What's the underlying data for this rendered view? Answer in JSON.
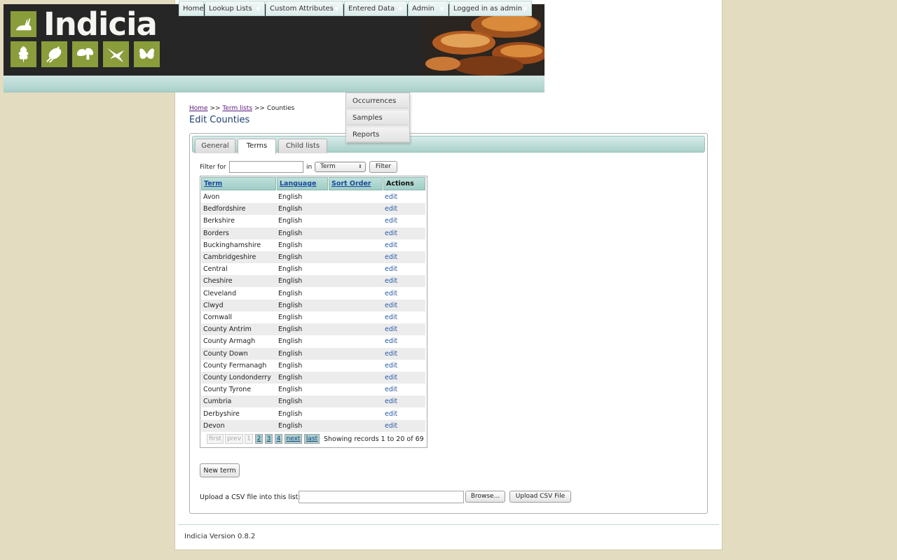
{
  "app": {
    "logo_text": "Indicia"
  },
  "nav": {
    "items": [
      {
        "label": "Home"
      },
      {
        "label": "Lookup Lists"
      },
      {
        "label": "Custom Attributes"
      },
      {
        "label": "Entered Data"
      },
      {
        "label": "Admin"
      },
      {
        "label": "Logged in as admin"
      }
    ],
    "dropdown": [
      "Occurrences",
      "Samples",
      "Reports"
    ]
  },
  "breadcrumb": {
    "home": "Home",
    "sep": ">>",
    "term_lists": "Term lists",
    "current": "Counties"
  },
  "page_title": "Edit Counties",
  "tabs": [
    {
      "label": "General"
    },
    {
      "label": "Terms"
    },
    {
      "label": "Child lists"
    }
  ],
  "filter": {
    "label": "Filter for",
    "in_label": "in",
    "value": "",
    "field": "Term",
    "button": "Filter"
  },
  "grid": {
    "headers": [
      "Term",
      "Language",
      "Sort Order",
      "Actions"
    ],
    "rows": [
      {
        "term": "Avon",
        "language": "English",
        "sort_order": "",
        "action": "edit"
      },
      {
        "term": "Bedfordshire",
        "language": "English",
        "sort_order": "",
        "action": "edit"
      },
      {
        "term": "Berkshire",
        "language": "English",
        "sort_order": "",
        "action": "edit"
      },
      {
        "term": "Borders",
        "language": "English",
        "sort_order": "",
        "action": "edit"
      },
      {
        "term": "Buckinghamshire",
        "language": "English",
        "sort_order": "",
        "action": "edit"
      },
      {
        "term": "Cambridgeshire",
        "language": "English",
        "sort_order": "",
        "action": "edit"
      },
      {
        "term": "Central",
        "language": "English",
        "sort_order": "",
        "action": "edit"
      },
      {
        "term": "Cheshire",
        "language": "English",
        "sort_order": "",
        "action": "edit"
      },
      {
        "term": "Cleveland",
        "language": "English",
        "sort_order": "",
        "action": "edit"
      },
      {
        "term": "Clwyd",
        "language": "English",
        "sort_order": "",
        "action": "edit"
      },
      {
        "term": "Cornwall",
        "language": "English",
        "sort_order": "",
        "action": "edit"
      },
      {
        "term": "County Antrim",
        "language": "English",
        "sort_order": "",
        "action": "edit"
      },
      {
        "term": "County Armagh",
        "language": "English",
        "sort_order": "",
        "action": "edit"
      },
      {
        "term": "County Down",
        "language": "English",
        "sort_order": "",
        "action": "edit"
      },
      {
        "term": "County Fermanagh",
        "language": "English",
        "sort_order": "",
        "action": "edit"
      },
      {
        "term": "County Londonderry",
        "language": "English",
        "sort_order": "",
        "action": "edit"
      },
      {
        "term": "County Tyrone",
        "language": "English",
        "sort_order": "",
        "action": "edit"
      },
      {
        "term": "Cumbria",
        "language": "English",
        "sort_order": "",
        "action": "edit"
      },
      {
        "term": "Derbyshire",
        "language": "English",
        "sort_order": "",
        "action": "edit"
      },
      {
        "term": "Devon",
        "language": "English",
        "sort_order": "",
        "action": "edit"
      }
    ]
  },
  "pager": {
    "first": "first",
    "prev": "prev",
    "pages": [
      "1",
      "2",
      "3",
      "4"
    ],
    "next": "next",
    "last": "last",
    "info": "Showing records 1 to 20 of 69"
  },
  "new_term_button": "New term",
  "upload": {
    "label": "Upload a CSV file into this list:",
    "browse": "Browse...",
    "button": "Upload CSV File"
  },
  "footer": {
    "version": "Indicia Version 0.8.2"
  },
  "colors": {
    "background": "#e3dcc0",
    "banner": "#262626",
    "tile_green": "#8a9d3b",
    "nav_teal": "#a9d0ca",
    "title_blue": "#1c3f6e"
  }
}
